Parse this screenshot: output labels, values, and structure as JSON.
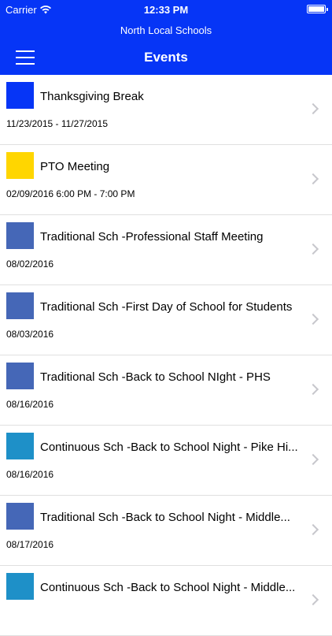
{
  "status_bar": {
    "carrier": "Carrier",
    "time": "12:33 PM"
  },
  "header": {
    "school_name": "North Local Schools",
    "title": "Events"
  },
  "events": [
    {
      "title": "Thanksgiving Break",
      "date": "11/23/2015 - 11/27/2015",
      "color": "#0635f6"
    },
    {
      "title": "PTO Meeting",
      "date": "02/09/2016 6:00 PM - 7:00 PM",
      "color": "#ffd600"
    },
    {
      "title": "Traditional Sch -Professional Staff Meeting",
      "date": "08/02/2016",
      "color": "#4567b7"
    },
    {
      "title": "Traditional Sch -First Day of School for Students",
      "date": "08/03/2016",
      "color": "#4567b7"
    },
    {
      "title": "Traditional Sch -Back to School NIght - PHS",
      "date": "08/16/2016",
      "color": "#4567b7"
    },
    {
      "title": "Continuous Sch -Back to School Night - Pike Hi...",
      "date": "08/16/2016",
      "color": "#1e90c8"
    },
    {
      "title": "Traditional Sch -Back to School Night - Middle...",
      "date": "08/17/2016",
      "color": "#4567b7"
    },
    {
      "title": "Continuous Sch -Back to School Night - Middle...",
      "date": "",
      "color": "#1e90c8"
    }
  ]
}
